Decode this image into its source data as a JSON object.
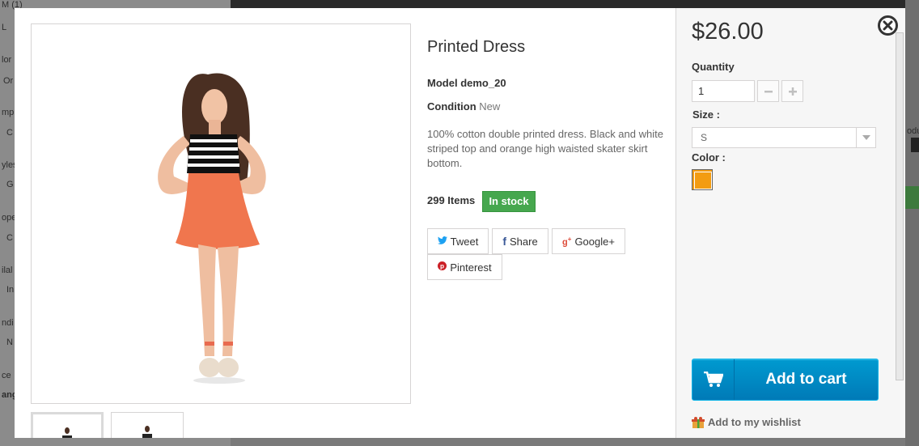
{
  "product": {
    "title": "Printed Dress",
    "model_label": "Model",
    "model_value": "demo_20",
    "condition_label": "Condition",
    "condition_value": "New",
    "description": "100% cotton double printed dress. Black and white striped top and orange high waisted skater skirt bottom.",
    "quantity_in_stock": "299 Items",
    "stock_status": "In stock"
  },
  "social": {
    "tweet": "Tweet",
    "share": "Share",
    "google": "Google+",
    "pinterest": "Pinterest"
  },
  "purchase": {
    "price": "$26.00",
    "quantity_label": "Quantity",
    "quantity_value": "1",
    "size_label": "Size :",
    "size_value": "S",
    "color_label": "Color :",
    "selected_color": "#f39c11",
    "add_to_cart": "Add to cart",
    "wishlist": "Add to my wishlist"
  },
  "background": {
    "left_snippets": [
      "M (1)",
      "L",
      "lor",
      "Or",
      "mp",
      "C",
      "yles",
      "G",
      "ope",
      "C",
      "ilal",
      "In",
      "ndi",
      "N",
      "ce",
      "ang"
    ],
    "right_snippet": "odu"
  },
  "colors": {
    "stock_green": "#46a74e",
    "cart_blue": "#0089c7",
    "dress_orange": "#f0764e"
  }
}
